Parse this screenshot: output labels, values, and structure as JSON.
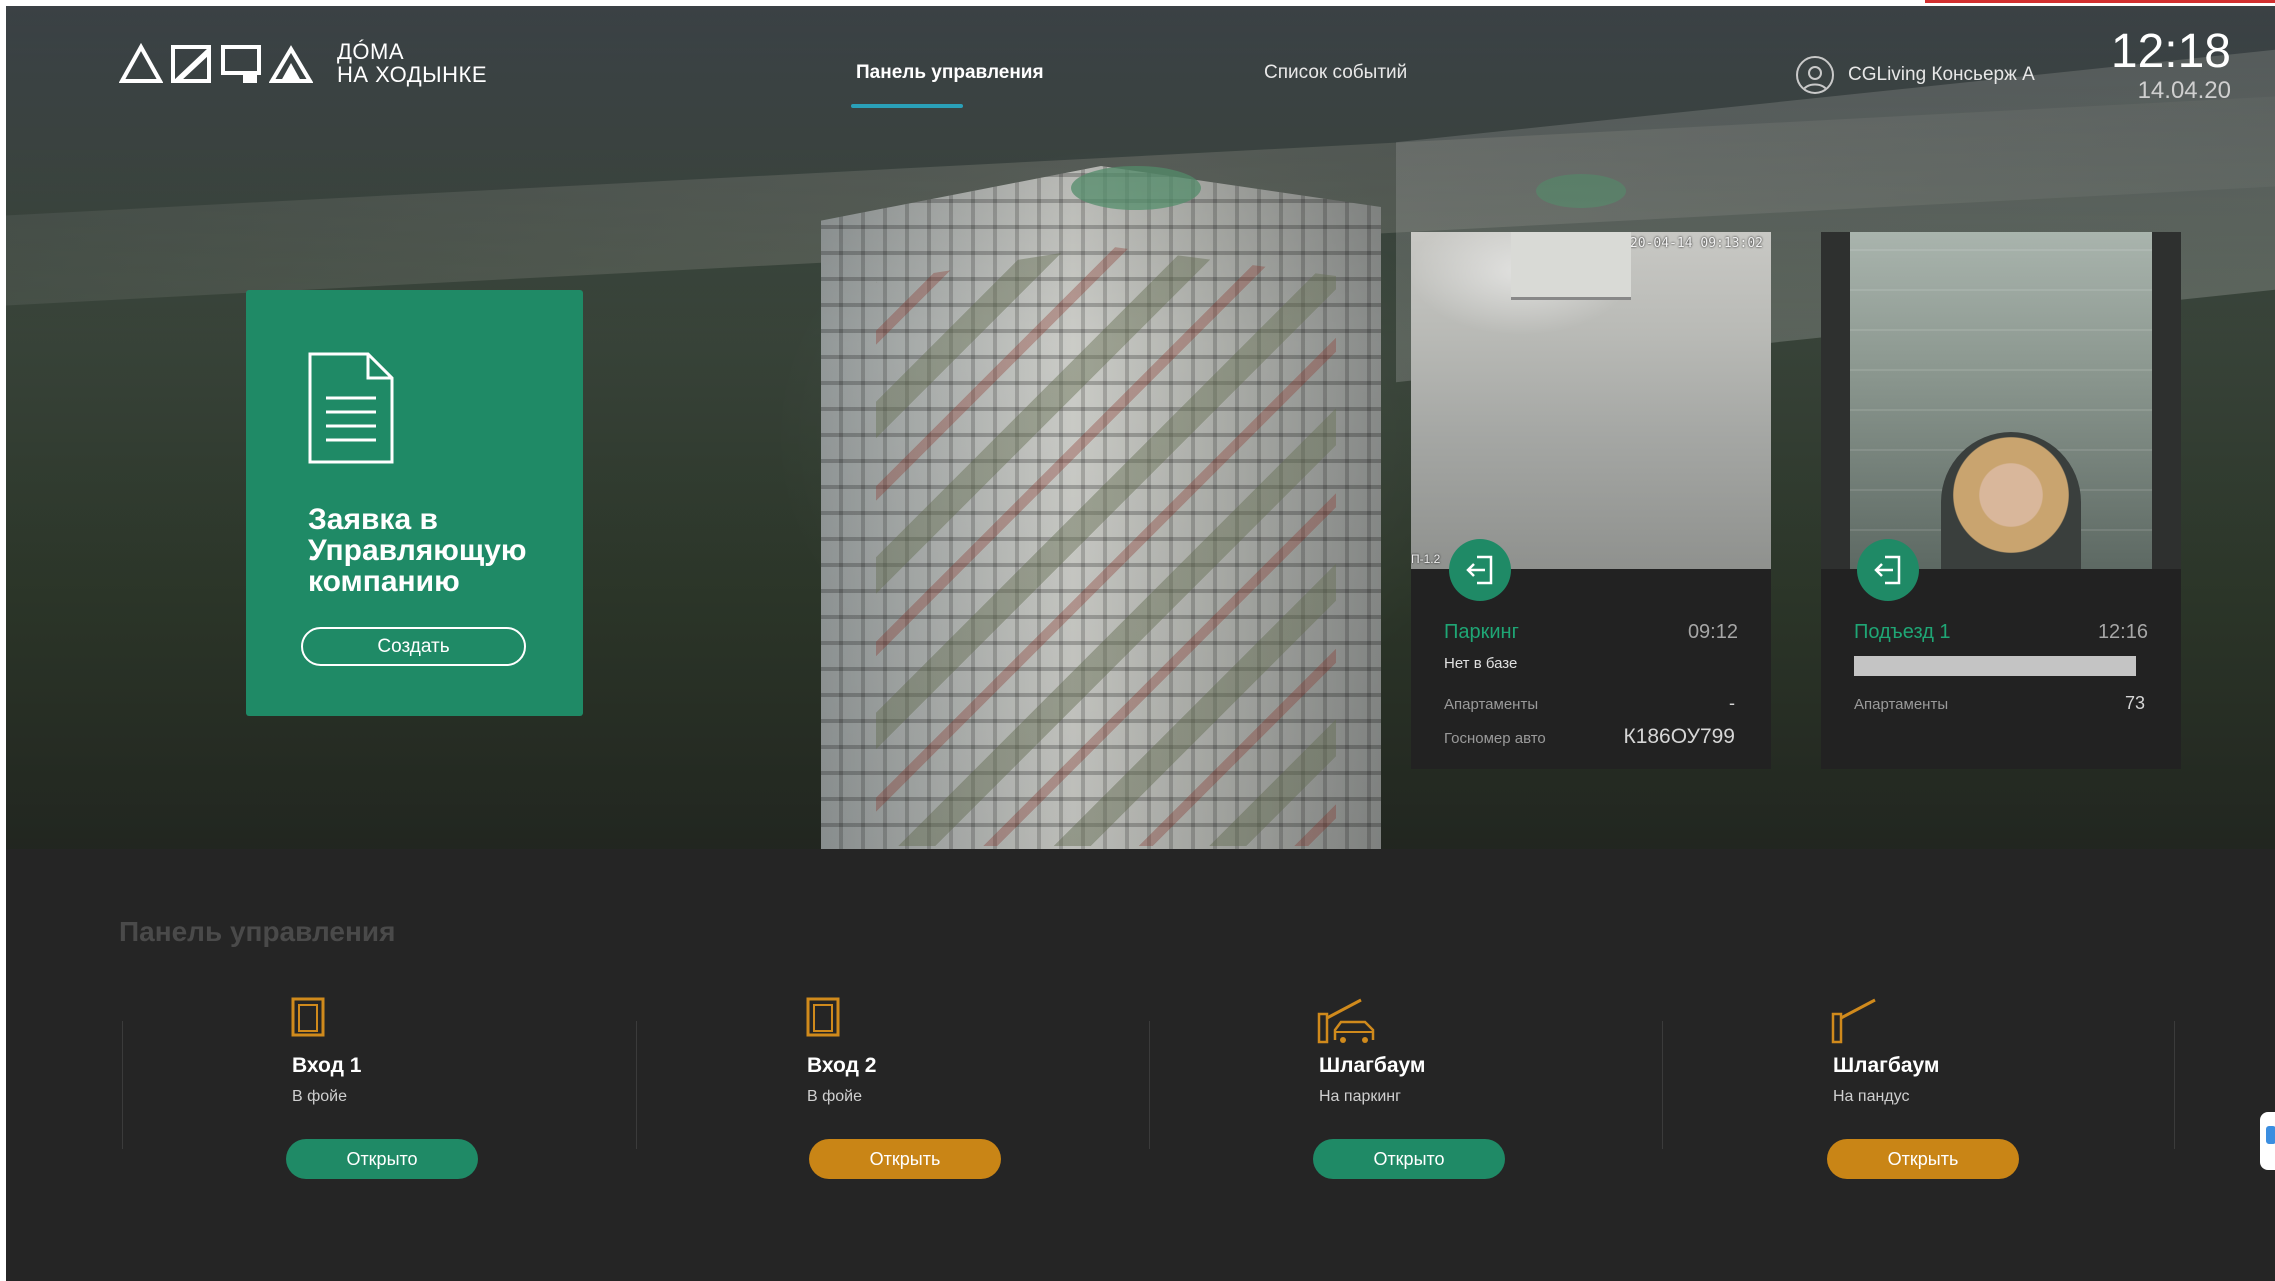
{
  "logo": {
    "line1": "ДÓМА",
    "line2": "НА ХОДЫНКЕ"
  },
  "nav": {
    "tabs": [
      {
        "label": "Панель управления",
        "active": true
      },
      {
        "label": "Список событий",
        "active": false
      }
    ]
  },
  "user": {
    "name": "CGLiving Консьерж А",
    "icon": "user-icon"
  },
  "clock": {
    "time": "12:18",
    "date": "14.04.20"
  },
  "request": {
    "title": "Заявка в Управляющую компанию",
    "button": "Создать",
    "icon": "document-icon"
  },
  "cameras": {
    "parking": {
      "stamp": "2020-04-14 09:13:02",
      "side_label": "П-1.2",
      "label": "Паркинг",
      "time": "09:12",
      "status": "Нет в базе",
      "apartments_label": "Апартаменты",
      "apartments_value": "-",
      "plate_label": "Госномер авто",
      "plate_value": "К186ОУ799",
      "icon": "enter-icon"
    },
    "entrance": {
      "label": "Подъезд 1",
      "time": "12:16",
      "apartments_label": "Апартаменты",
      "apartments_value": "73",
      "icon": "enter-icon"
    }
  },
  "panel": {
    "title": "Панель управления",
    "controls": [
      {
        "title": "Вход 1",
        "subtitle": "В фойе",
        "button": "Открыто",
        "state": "open",
        "icon": "door-icon"
      },
      {
        "title": "Вход 2",
        "subtitle": "В фойе",
        "button": "Открыть",
        "state": "closed",
        "icon": "door-icon"
      },
      {
        "title": "Шлагбаум",
        "subtitle": "На паркинг",
        "button": "Открыто",
        "state": "open",
        "icon": "barrier-car-icon"
      },
      {
        "title": "Шлагбаум",
        "subtitle": "На пандус",
        "button": "Открыть",
        "state": "closed",
        "icon": "barrier-icon"
      }
    ]
  },
  "colors": {
    "accent_green": "#1f8a66",
    "accent_orange": "#c98516",
    "tab_underline": "#2aa0b8",
    "icon_orange": "#d08a1c"
  }
}
